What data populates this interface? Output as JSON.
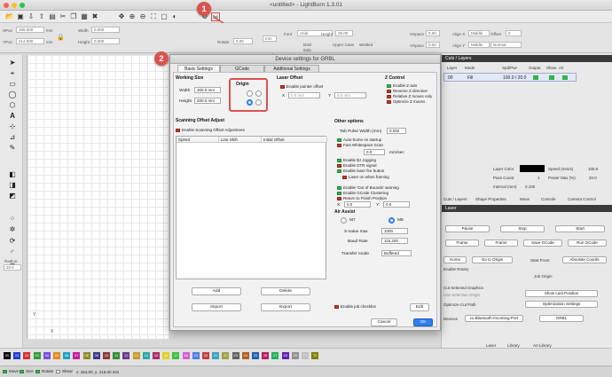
{
  "window": {
    "title": "<untitled> - LightBurn 1.3.01"
  },
  "props": {
    "xpos_label": "XPos",
    "xpos_value": "165.000",
    "ypos_label": "YPos",
    "ypos_value": "214.500",
    "width_label": "Width",
    "width_value": "0.000",
    "height_label": "Height",
    "height_value": "0.000",
    "rotate_label": "Rotate",
    "rotate_value": "0.00",
    "unit": "mm",
    "font_label": "Font",
    "font_value": "Arial",
    "height2_label": "Height",
    "height2_value": "25.00",
    "bold": "Bold",
    "italic": "Italic",
    "upper": "Upper Case",
    "welded": "Welded",
    "hspace_label": "HSpace",
    "hspace_value": "0.00",
    "vspace_label": "VSpace",
    "vspace_value": "0.00",
    "align_x": "Align X",
    "align_y": "Align Y",
    "offset_label": "Offset",
    "offset_value": "0",
    "middle_value": "Middle",
    "normal_value": "Normal",
    "xpos_unit": "mm",
    "ypos_unit": "mm"
  },
  "left_tools": {
    "radius_label": "Radius:",
    "radius_value": "10.0"
  },
  "dialog": {
    "title": "Device settings for GRBL",
    "tabs": [
      "Basic Settings",
      "GCode",
      "Additional Settings"
    ],
    "working_size": {
      "heading": "Working Size",
      "width_label": "Width",
      "width_value": "300.0 mm",
      "height_label": "Height",
      "height_value": "200.0 mm"
    },
    "origin": {
      "heading": "Origin"
    },
    "laser_offset": {
      "heading": "Laser Offset",
      "enable": "Enable pointer offset",
      "x_label": "X",
      "x_value": "0.0 mm",
      "y_label": "Y",
      "y_value": "0.0 mm"
    },
    "z_control": {
      "heading": "Z Control",
      "items": [
        "Enable Z axis",
        "Reverse Z direction",
        "Relative Z moves only",
        "Optimize Z moves"
      ]
    },
    "scanning": {
      "heading": "Scanning Offset Adjust",
      "enable": "Enable Scanning Offset Adjustment",
      "col_speed": "Speed",
      "col_line": "Line Shift",
      "col_initial": "Initial Offset"
    },
    "other": {
      "heading": "Other options",
      "tab_pulse_label": "Tab Pulse Width (mm)",
      "tab_pulse_value": "0.050",
      "cb1": "Auto-home on startup",
      "cb2": "Fast Whitespace Scan",
      "mms_value": "0.0",
      "mms_unit": "mm/sec",
      "cb3": "Enable $J Jogging",
      "cb4": "Enable DTR signal",
      "cb5": "Enable laser fire button",
      "cb6": "Laser on when framing",
      "cb7": "Enable 'Out of Bounds' warning",
      "cb8": "Enable GCode Clustering",
      "cb9": "Return to Finish Position",
      "x_label": "X:",
      "x_value": "0.0",
      "y_label": "Y:",
      "y_value": "0.0",
      "air_assist": "Air Assist",
      "m7": "M7",
      "m8": "M8",
      "svalue_label": "S-value max",
      "svalue_value": "1000",
      "baud_label": "Baud Rate",
      "baud_value": "115,200",
      "transfer_label": "Transfer mode",
      "transfer_value": "Buffered",
      "job_checklist": "Enable job checklist"
    },
    "buttons": {
      "add": "Add",
      "delete": "Delete",
      "import": "Import",
      "export": "Export",
      "edit": "Edit",
      "cancel": "Cancel",
      "ok": "OK"
    }
  },
  "right_panel": {
    "layers_title": "Cuts / Layers",
    "cols": [
      "Layer",
      "Mode",
      "Spd/Pwr",
      "Output",
      "Show",
      "Air"
    ],
    "row_layer": "00",
    "row_mode": "Fill",
    "row_spdpwr": "100.0 / 20.0",
    "layer_color": "Layer Color",
    "speed_label": "Speed (mm/s)",
    "speed_value": "100.0",
    "pass_label": "Pass Count",
    "pass_value": "1",
    "power_label": "Power Max (%)",
    "power_value": "20.0",
    "interval_label": "Interval (mm)",
    "interval_value": "0.100",
    "tabs": [
      "Cuts / Layers",
      "Shape Properties",
      "Move",
      "Console",
      "Camera Control"
    ],
    "laser_title": "Laser",
    "pause": "Pause",
    "stop": "Stop",
    "start": "Start",
    "frame1": "Frame",
    "frame2": "Frame",
    "save_gcode": "Save GCode",
    "run_gcode": "Run GCode",
    "home": "Home",
    "go_origin": "Go to Origin",
    "start_from": "Start From:",
    "start_from_value": "Absolute Coords",
    "rotary": "Enable Rotary",
    "job_origin": "Job Origin",
    "selected_graphics": "Cut Selected Graphics",
    "selection_origin": "Use Selection Origin",
    "optimize_path": "Optimize Cut Path",
    "show_last": "Show Last Position",
    "opt_settings": "Optimization Settings",
    "devices": "Devices",
    "port_value": "cu.Bluetooth-Incoming-Port",
    "grbl": "GRBL",
    "bottom_tabs": [
      "Laser",
      "Library",
      "Art Library"
    ]
  },
  "status": {
    "move": "Move",
    "size": "Size",
    "rotate": "Rotate",
    "shear": "Shear",
    "coords": "x: 154.00, y: 216.00 mm"
  },
  "palette": {
    "labels": [
      "00",
      "01",
      "02",
      "03",
      "04",
      "05",
      "06",
      "07",
      "08",
      "09",
      "10",
      "11",
      "12",
      "13",
      "14",
      "15",
      "16",
      "17",
      "18",
      "19",
      "20",
      "21",
      "22",
      "23",
      "24",
      "25",
      "26",
      "27",
      "28",
      "29",
      "T1",
      "T2"
    ]
  },
  "annotations": {
    "one": "1",
    "two": "2"
  },
  "canvas": {
    "axis_x": "X",
    "axis_y": "Y"
  }
}
